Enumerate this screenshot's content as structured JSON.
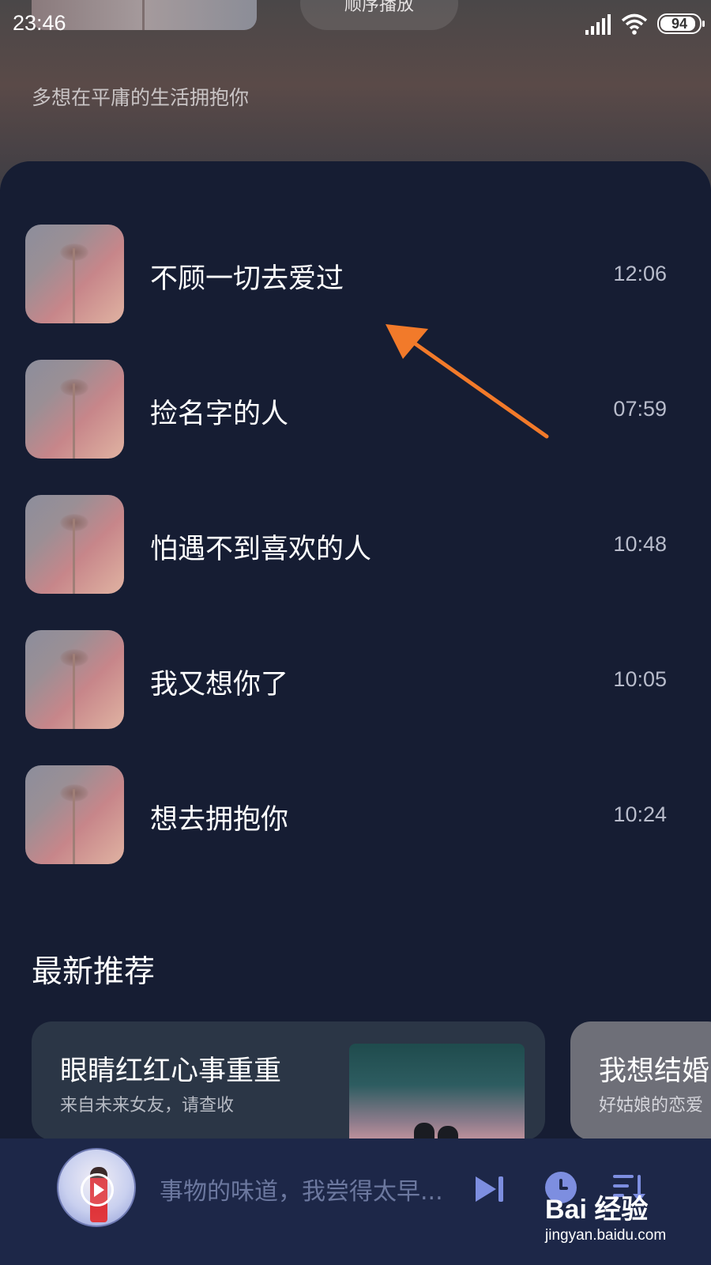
{
  "status_bar": {
    "time": "23:46",
    "battery": "94",
    "signal_icon": "cellular-signal-icon",
    "wifi_icon": "wifi-icon"
  },
  "header": {
    "play_order_label": "顺序播放",
    "description": "多想在平庸的生活拥抱你"
  },
  "songs": [
    {
      "title": "不顾一切去爱过",
      "duration": "12:06"
    },
    {
      "title": "捡名字的人",
      "duration": "07:59"
    },
    {
      "title": "怕遇不到喜欢的人",
      "duration": "10:48"
    },
    {
      "title": "我又想你了",
      "duration": "10:05"
    },
    {
      "title": "想去拥抱你",
      "duration": "10:24"
    }
  ],
  "recommend": {
    "section_title": "最新推荐",
    "cards": [
      {
        "title": "眼睛红红心事重重",
        "subtitle": "来自未来女友，请查收"
      },
      {
        "title": "我想结婚",
        "subtitle": "好姑娘的恋爱"
      }
    ]
  },
  "player": {
    "now_playing": "事物的味道，我尝得太早...",
    "next_icon": "skip-next-icon",
    "timer_icon": "clock-icon",
    "playlist_icon": "playlist-icon"
  },
  "watermark": {
    "logo": "Bai 经验",
    "url": "jingyan.baidu.com"
  },
  "colors": {
    "panel_bg": "#161d33",
    "player_bg": "#1d2748",
    "accent_arrow": "#f27a2a",
    "accent_icon": "#7d8ee0"
  }
}
